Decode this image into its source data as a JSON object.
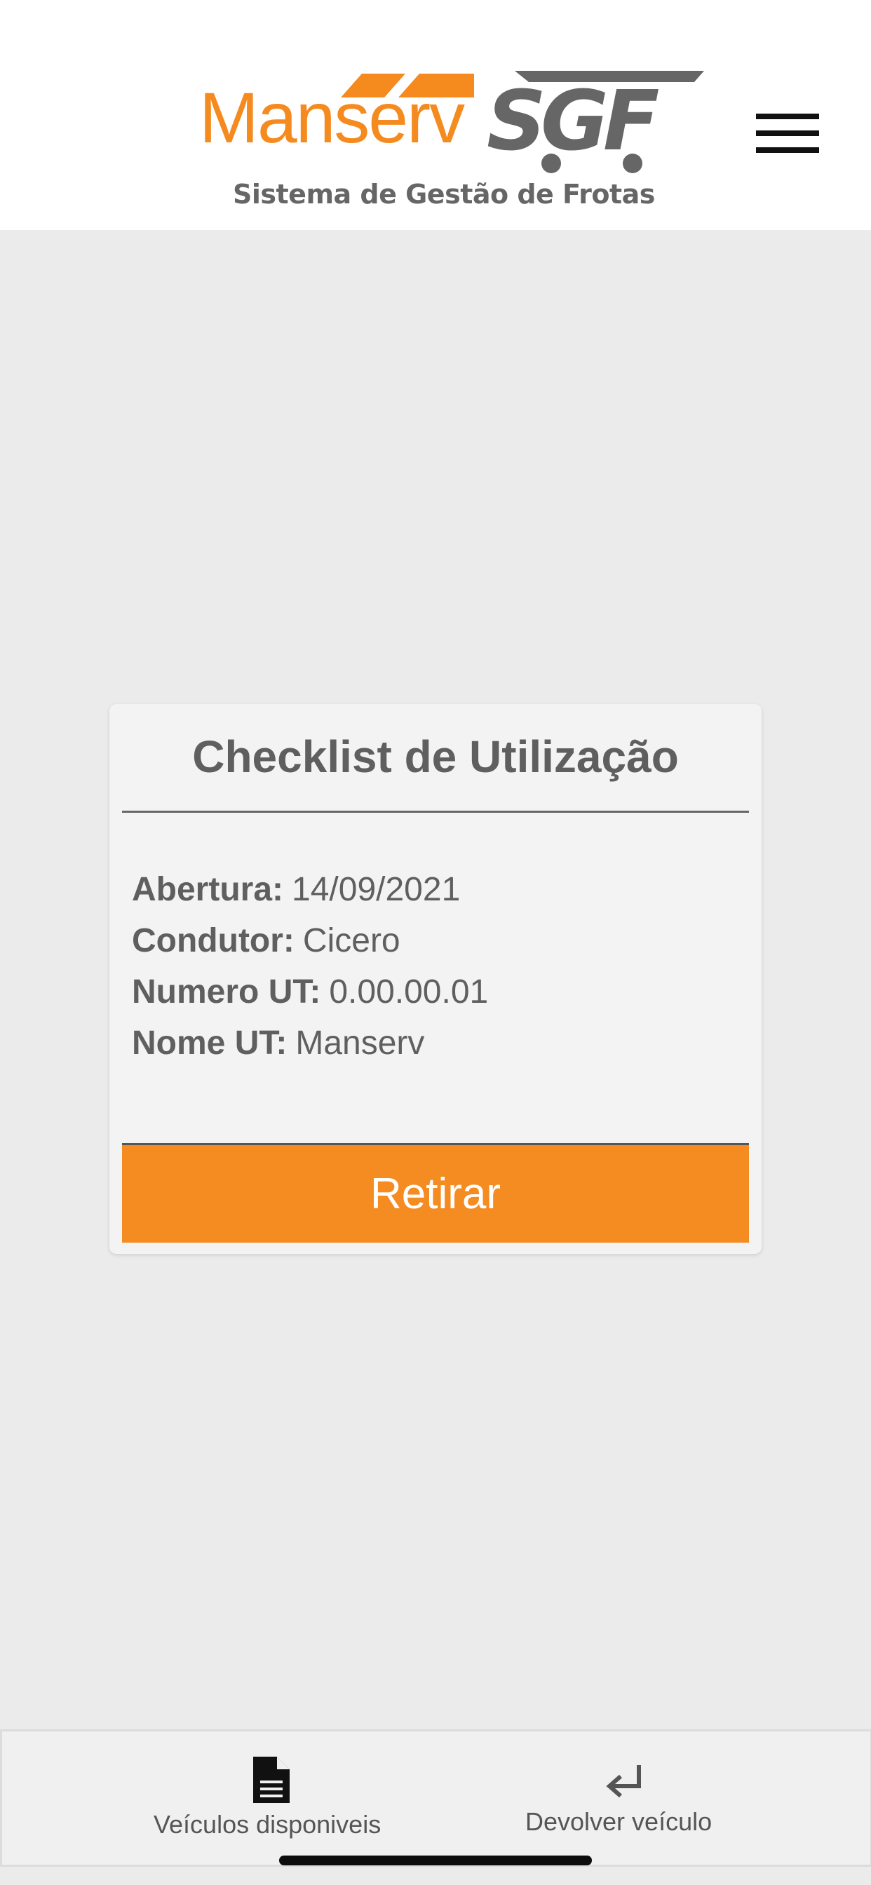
{
  "header": {
    "logo_brand": "Manserv",
    "logo_product": "SGF",
    "logo_tagline": "Sistema de Gestão de Frotas",
    "menu_icon": "hamburger-menu-icon"
  },
  "card": {
    "title": "Checklist de Utilização",
    "fields": [
      {
        "label": "Abertura:",
        "value": "14/09/2021"
      },
      {
        "label": "Condutor:",
        "value": "Cicero"
      },
      {
        "label": "Numero UT:",
        "value": "0.00.00.01"
      },
      {
        "label": "Nome UT:",
        "value": "Manserv"
      }
    ],
    "action_label": "Retirar"
  },
  "tabbar": {
    "tabs": [
      {
        "label": "Veículos disponiveis",
        "icon": "document-icon"
      },
      {
        "label": "Devolver veículo",
        "icon": "return-arrow-icon"
      }
    ]
  },
  "colors": {
    "brand_orange": "#f48c22",
    "logo_gray": "#666666",
    "background": "#ebebeb",
    "card": "#f3f3f3"
  }
}
